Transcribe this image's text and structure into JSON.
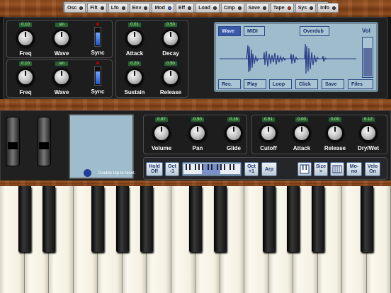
{
  "menu": [
    {
      "label": "Osc",
      "led": "off"
    },
    {
      "label": "Filt",
      "led": "off"
    },
    {
      "label": "Lfo",
      "led": "off"
    },
    {
      "label": "Env",
      "led": "off"
    },
    {
      "label": "Mod",
      "led": "blue"
    },
    {
      "label": "Eff",
      "led": "off"
    },
    {
      "label": "Load",
      "led": "off"
    },
    {
      "label": "Cmp",
      "led": "off"
    },
    {
      "label": "Save",
      "led": "off"
    },
    {
      "label": "Tape",
      "led": "red"
    },
    {
      "label": "Sys",
      "led": "off"
    },
    {
      "label": "Info",
      "led": "off"
    }
  ],
  "lfo1": {
    "freq_value": "0.10",
    "freq_label": "Freq",
    "wave_value": "sin",
    "wave_label": "Wave",
    "sync_label": "Sync"
  },
  "lfo2": {
    "freq_value": "0.10",
    "freq_label": "Freq",
    "wave_value": "sin",
    "wave_label": "Wave",
    "sync_label": "Sync"
  },
  "env": {
    "attack_value": "0.01",
    "attack_label": "Attack",
    "decay_value": "0.50",
    "decay_label": "Decay",
    "sustain_value": "0.20",
    "sustain_label": "Sustain",
    "release_value": "0.50",
    "release_label": "Release"
  },
  "tape": {
    "wave_tab": "Wave",
    "midi_tab": "MIDI",
    "overdub": "Overdub",
    "vol": "Vol",
    "buttons": [
      "Rec.",
      "Play",
      "Loop",
      "Click",
      "Save",
      "Files"
    ]
  },
  "xy_hint": "Double tap to reset.",
  "master": {
    "volume_value": "0.87",
    "volume_label": "Volume",
    "pan_value": "0.50",
    "pan_label": "Pan",
    "glide_value": "0.16",
    "glide_label": "Glide"
  },
  "perf": {
    "cutoff_value": "0.51",
    "cutoff_label": "Cutoff",
    "attack_value": "0.00",
    "attack_label": "Attack",
    "release_value": "0.00",
    "release_label": "Release",
    "drywet_value": "0.12",
    "drywet_label": "Dry/Wet"
  },
  "keyboard_bar": {
    "hold": "Hold\nOff",
    "oct_down": "Oct\n-1",
    "oct_up": "Oct\n+1",
    "arp": "Arp",
    "size": "Size\n>",
    "mono": "Mo-\nno",
    "velo": "Velo\nOn"
  }
}
